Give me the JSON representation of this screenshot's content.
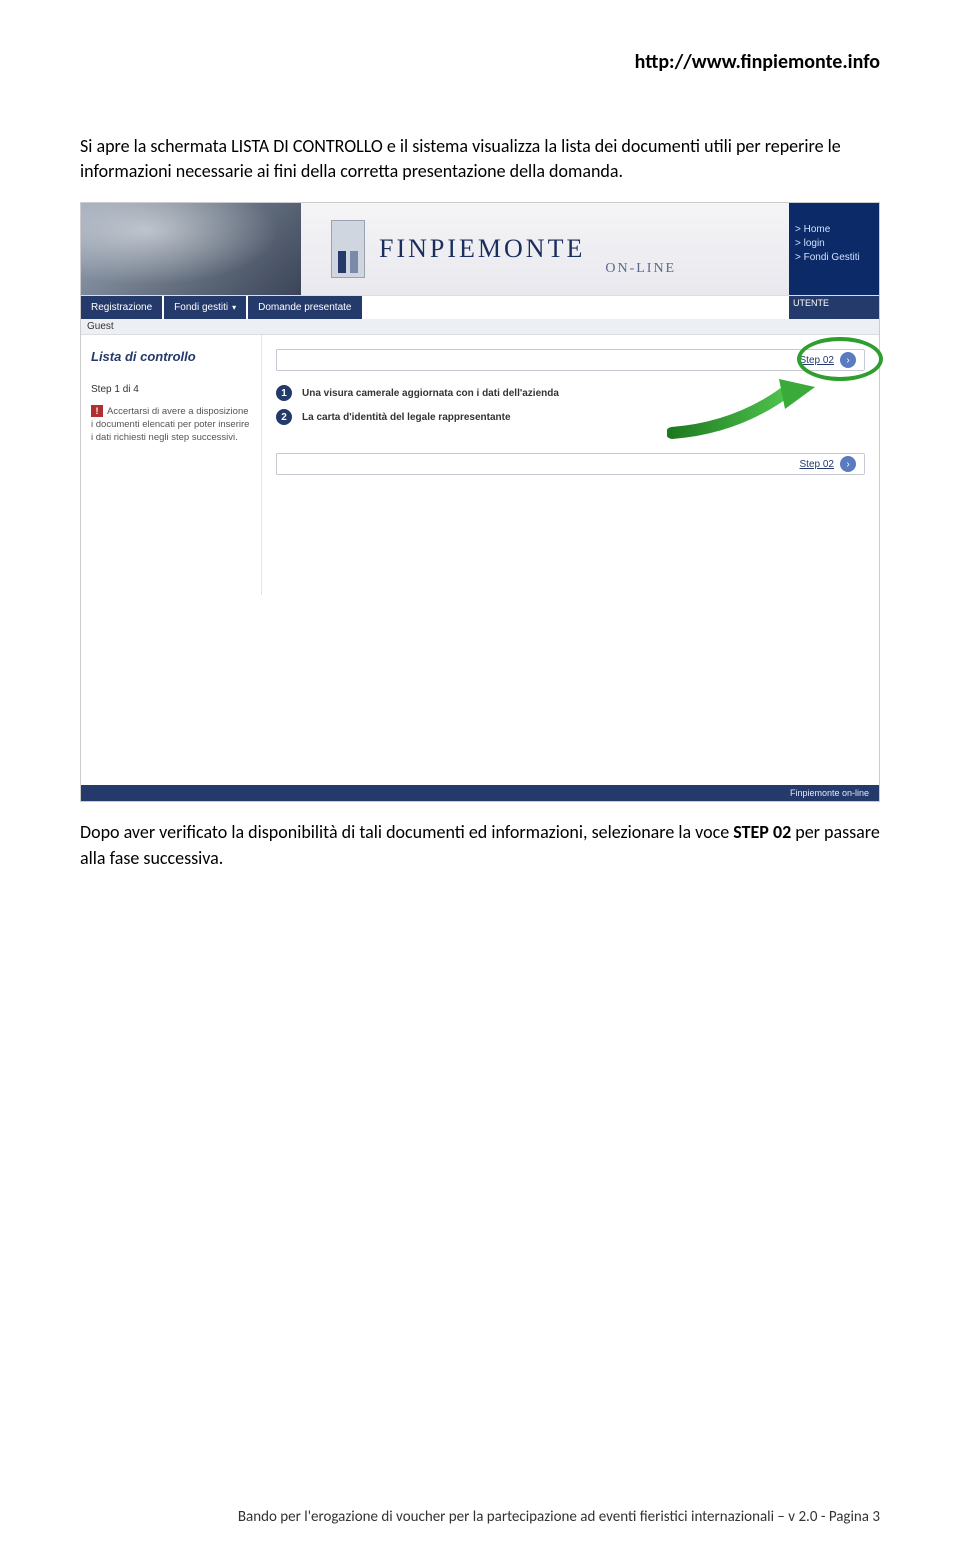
{
  "doc": {
    "header_url": "http://www.finpiemonte.info",
    "intro": "Si apre la schermata LISTA DI CONTROLLO e il sistema visualizza la lista dei documenti utili per reperire le informazioni necessarie ai fini della corretta presentazione della domanda.",
    "after_prefix": "Dopo aver verificato la disponibilità di tali documenti ed informazioni, selezionare la voce ",
    "after_bold": "STEP 02",
    "after_suffix": " per passare alla fase successiva.",
    "footer": "Bando per l'erogazione di voucher per la partecipazione ad eventi fieristici internazionali – v 2.0 - Pagina 3"
  },
  "app": {
    "brand": "FINPIEMONTE",
    "brand_suffix": "ON-LINE",
    "rightnav": [
      "> Home",
      "> login",
      "> Fondi Gestiti"
    ],
    "menu": {
      "registrazione": "Registrazione",
      "fondi": "Fondi gestiti",
      "domande": "Domande presentate"
    },
    "user_label": "UTENTE",
    "guest": "Guest",
    "sidebar": {
      "title": "Lista di controllo",
      "step": "Step 1 di 4",
      "note": "Accertarsi di avere a disposizione i documenti elencati per poter inserire i dati richiesti negli step successivi."
    },
    "checklist": [
      "Una visura camerale aggiornata con i dati dell'azienda",
      "La carta d'identità del legale rappresentante"
    ],
    "step_label": "Step 02",
    "footer": "Finpiemonte on-line"
  }
}
